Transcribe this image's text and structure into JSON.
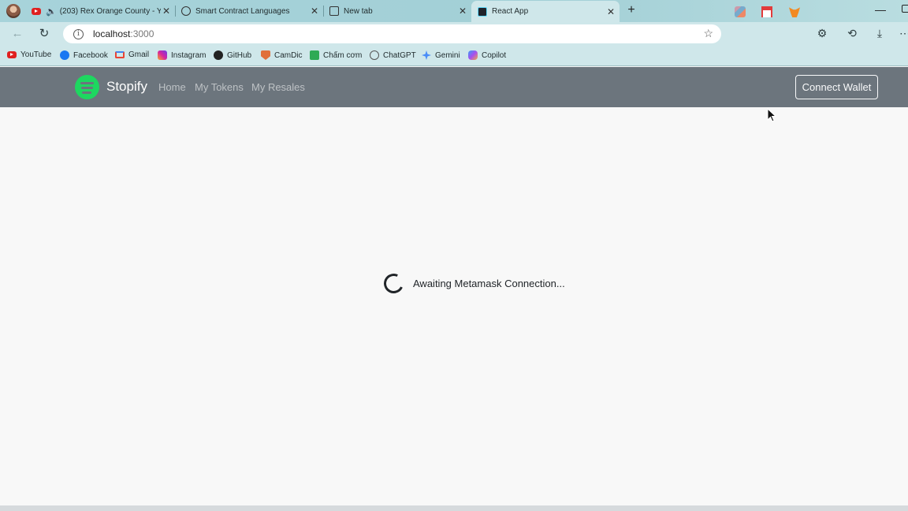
{
  "browser": {
    "tabs": [
      {
        "title": "(203) Rex Orange County - Y",
        "icon": "youtube-icon",
        "audio": true
      },
      {
        "title": "Smart Contract Languages",
        "icon": "chatgpt-icon"
      },
      {
        "title": "New tab",
        "icon": "newtab-icon"
      },
      {
        "title": "React App",
        "icon": "react-icon",
        "active": true
      }
    ],
    "url_host": "localhost",
    "url_port": ":3000",
    "bookmarks": [
      {
        "label": "YouTube",
        "icon": "youtube-icon",
        "color": "#e02020"
      },
      {
        "label": "Facebook",
        "icon": "facebook-icon",
        "color": "#1877f2"
      },
      {
        "label": "Gmail",
        "icon": "gmail-icon",
        "color": "#ea4335"
      },
      {
        "label": "Instagram",
        "icon": "instagram-icon",
        "color": "#d6249f"
      },
      {
        "label": "GitHub",
        "icon": "github-icon",
        "color": "#222222"
      },
      {
        "label": "CamDic",
        "icon": "camdic-icon",
        "color": "#e0703a"
      },
      {
        "label": "Chấm cơm",
        "icon": "sheets-icon",
        "color": "#2eaa55"
      },
      {
        "label": "ChatGPT",
        "icon": "chatgpt-icon",
        "color": "#555555"
      },
      {
        "label": "Gemini",
        "icon": "gemini-icon",
        "color": "#4a8df8"
      },
      {
        "label": "Copilot",
        "icon": "copilot-icon",
        "color": "#6d6ef0"
      }
    ]
  },
  "app": {
    "brand": "Stopify",
    "nav": [
      "Home",
      "My Tokens",
      "My Resales"
    ],
    "connect_label": "Connect Wallet",
    "loading_text": "Awaiting Metamask Connection...",
    "accent": "#1ed760",
    "navbar_color": "#6c757d"
  }
}
